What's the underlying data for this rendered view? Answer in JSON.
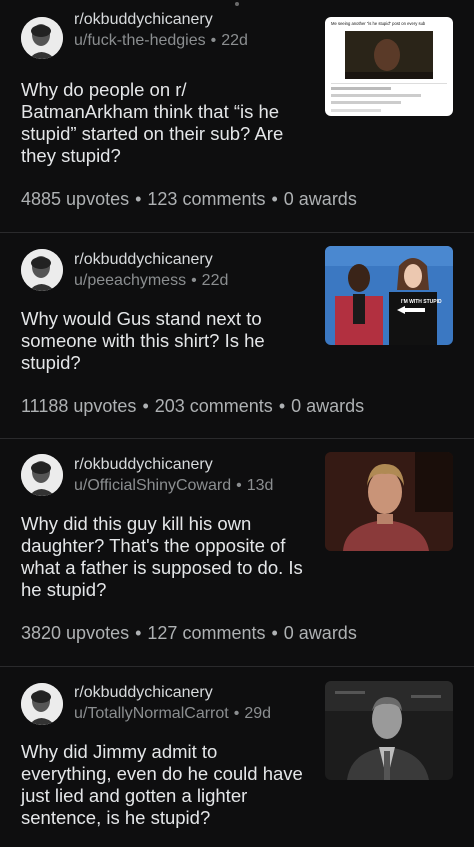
{
  "posts": [
    {
      "subreddit": "r/okbuddychicanery",
      "user": "u/fuck-the-hedgies",
      "age": "22d",
      "title": "Why do people on r/ BatmanArkham think that “is he stupid” started on their sub? Are they stupid?",
      "upvotes": "4885 upvotes",
      "comments": "123 comments",
      "awards": "0 awards",
      "thumb_caption": "Me seeing another \"is he stupid\" post on every sub"
    },
    {
      "subreddit": "r/okbuddychicanery",
      "user": "u/peeachymess",
      "age": "22d",
      "title": "Why would Gus stand next to someone with this shirt? Is he stupid?",
      "upvotes": "11188 upvotes",
      "comments": "203 comments",
      "awards": "0 awards",
      "thumb_caption": "I'M WITH STUPID"
    },
    {
      "subreddit": "r/okbuddychicanery",
      "user": "u/OfficialShinyCoward",
      "age": "13d",
      "title": "Why did this guy kill his own daughter? That's the opposite of what a father is supposed to do. Is he stupid?",
      "upvotes": "3820 upvotes",
      "comments": "127 comments",
      "awards": "0 awards"
    },
    {
      "subreddit": "r/okbuddychicanery",
      "user": "u/TotallyNormalCarrot",
      "age": "29d",
      "title": "Why did Jimmy admit to everything, even do he could have just lied and gotten a lighter sentence, is he stupid?"
    }
  ]
}
